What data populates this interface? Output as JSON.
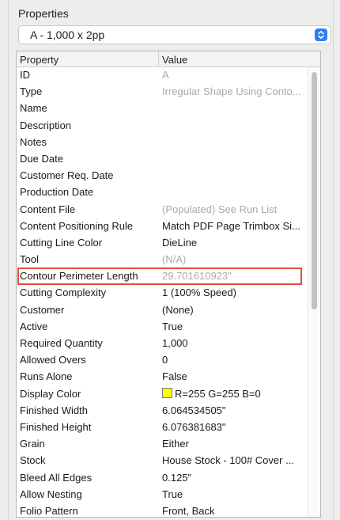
{
  "panel": {
    "title": "Properties"
  },
  "selector": {
    "value": "A - 1,000 x 2pp",
    "icon": "chevron-updown-icon",
    "accent": "#2f7cf6"
  },
  "table": {
    "columns": [
      "Property",
      "Value"
    ],
    "rows": [
      {
        "name": "ID",
        "value": "A",
        "muted": true
      },
      {
        "name": "Type",
        "value": "Irregular Shape Using Conto...",
        "muted": true
      },
      {
        "name": "Name",
        "value": ""
      },
      {
        "name": "Description",
        "value": ""
      },
      {
        "name": "Notes",
        "value": ""
      },
      {
        "name": "Due Date",
        "value": ""
      },
      {
        "name": "Customer Req. Date",
        "value": ""
      },
      {
        "name": "Production Date",
        "value": ""
      },
      {
        "name": "Content File",
        "value": "(Populated) See Run List",
        "muted": true
      },
      {
        "name": "Content Positioning Rule",
        "value": "Match PDF Page Trimbox Si..."
      },
      {
        "name": "Cutting Line Color",
        "value": "DieLine"
      },
      {
        "name": "Tool",
        "value": "(N/A)",
        "muted": true
      },
      {
        "name": "Contour Perimeter Length",
        "value": "29.701610923\"",
        "muted": true,
        "highlighted": true
      },
      {
        "name": "Cutting Complexity",
        "value": "1 (100% Speed)"
      },
      {
        "name": "Customer",
        "value": "(None)"
      },
      {
        "name": "Active",
        "value": "True"
      },
      {
        "name": "Required Quantity",
        "value": "1,000"
      },
      {
        "name": "Allowed Overs",
        "value": "0"
      },
      {
        "name": "Runs Alone",
        "value": "False"
      },
      {
        "name": "Display Color",
        "value": "R=255 G=255 B=0",
        "swatch": "#ffff00"
      },
      {
        "name": "Finished Width",
        "value": "6.064534505\""
      },
      {
        "name": "Finished Height",
        "value": "6.076381683\""
      },
      {
        "name": "Grain",
        "value": "Either"
      },
      {
        "name": "Stock",
        "value": "House Stock - 100# Cover ..."
      },
      {
        "name": "Bleed All Edges",
        "value": "0.125\""
      },
      {
        "name": "Allow Nesting",
        "value": "True"
      },
      {
        "name": "Folio Pattern",
        "value": "Front, Back"
      }
    ]
  },
  "highlight_color": "#e74c3c"
}
